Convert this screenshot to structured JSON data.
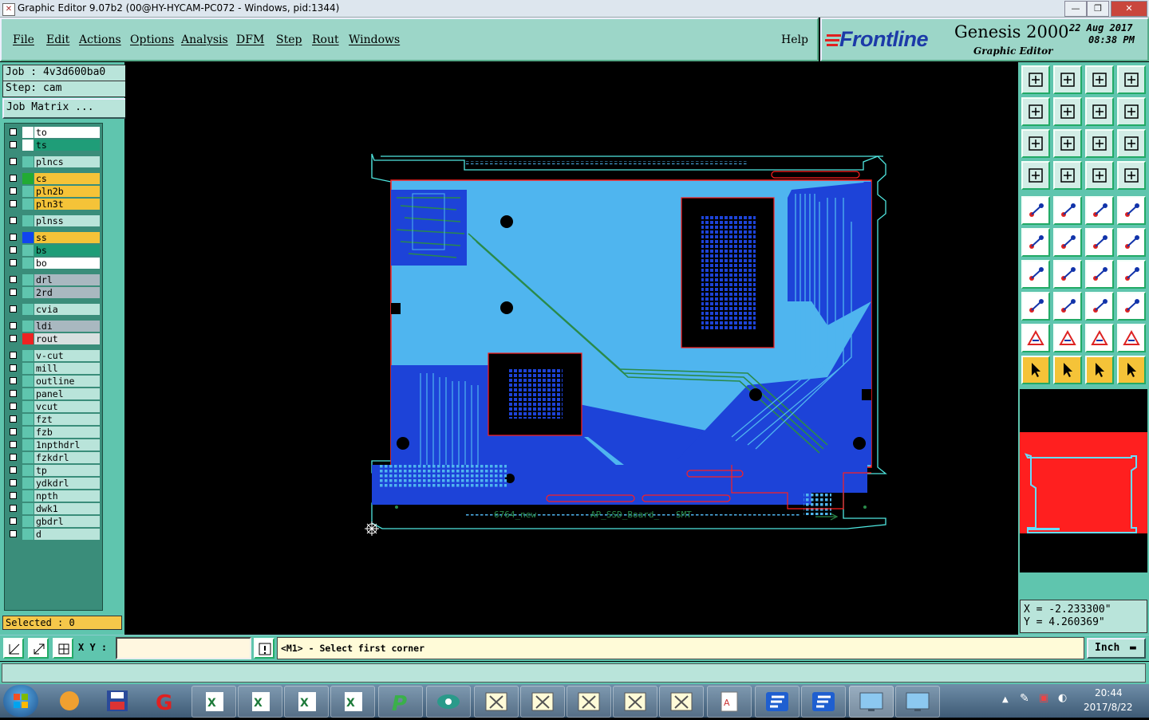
{
  "window": {
    "title": "Graphic Editor 9.07b2 (00@HY-HYCAM-PC072 - Windows, pid:1344)"
  },
  "menu": {
    "items": [
      "File",
      "Edit",
      "Actions",
      "Options",
      "Analysis",
      "DFM",
      "Step",
      "Rout",
      "Windows"
    ],
    "help": "Help"
  },
  "brand": {
    "logo": "Frontline",
    "product": "Genesis 2000",
    "subtitle": "Graphic Editor",
    "date": "22 Aug 2017",
    "time": "08:38 PM"
  },
  "job": {
    "job": "Job : 4v3d600ba0",
    "step": "Step: cam",
    "matrix_button": "Job Matrix ..."
  },
  "layers": [
    {
      "name": "to",
      "color": "#ffffff",
      "swatch": "#ffffff"
    },
    {
      "name": "ts",
      "color": "#1f9d78",
      "swatch": "#ffffff"
    },
    {
      "name": "plncs",
      "color": "#b9e4da",
      "swatch": "#5fc5ae"
    },
    {
      "name": "cs",
      "color": "#f5c338",
      "swatch": "#22aa33"
    },
    {
      "name": "pln2b",
      "color": "#f5c338",
      "swatch": "#5fc5ae"
    },
    {
      "name": "pln3t",
      "color": "#f5c338",
      "swatch": "#5fc5ae"
    },
    {
      "name": "plnss",
      "color": "#b9e4da",
      "swatch": "#5fc5ae"
    },
    {
      "name": "ss",
      "color": "#f5c338",
      "swatch": "#1144ee"
    },
    {
      "name": "bs",
      "color": "#1f9d78",
      "swatch": "#5fc5ae"
    },
    {
      "name": "bo",
      "color": "#ffffff",
      "swatch": "#5fc5ae"
    },
    {
      "name": "drl",
      "color": "#a9b8c0",
      "swatch": "#5fc5ae"
    },
    {
      "name": "2rd",
      "color": "#a9b8c0",
      "swatch": "#5fc5ae"
    },
    {
      "name": "cvia",
      "color": "#b9e4da",
      "swatch": "#5fc5ae"
    },
    {
      "name": "ldi",
      "color": "#a9b8c0",
      "swatch": "#5fc5ae"
    },
    {
      "name": "rout",
      "color": "#d8e0e0",
      "swatch": "#ee2222"
    },
    {
      "name": "v-cut",
      "color": "#b9e4da",
      "swatch": "#5fc5ae"
    },
    {
      "name": "mill",
      "color": "#b9e4da",
      "swatch": "#5fc5ae"
    },
    {
      "name": "outline",
      "color": "#b9e4da",
      "swatch": "#5fc5ae"
    },
    {
      "name": "panel",
      "color": "#b9e4da",
      "swatch": "#5fc5ae"
    },
    {
      "name": "vcut",
      "color": "#b9e4da",
      "swatch": "#5fc5ae"
    },
    {
      "name": "fzt",
      "color": "#b9e4da",
      "swatch": "#5fc5ae"
    },
    {
      "name": "fzb",
      "color": "#b9e4da",
      "swatch": "#5fc5ae"
    },
    {
      "name": "1npthdrl",
      "color": "#b9e4da",
      "swatch": "#5fc5ae"
    },
    {
      "name": "fzkdrl",
      "color": "#b9e4da",
      "swatch": "#5fc5ae"
    },
    {
      "name": "tp",
      "color": "#b9e4da",
      "swatch": "#5fc5ae"
    },
    {
      "name": "ydkdrl",
      "color": "#b9e4da",
      "swatch": "#5fc5ae"
    },
    {
      "name": "npth",
      "color": "#b9e4da",
      "swatch": "#5fc5ae"
    },
    {
      "name": "dwk1",
      "color": "#b9e4da",
      "swatch": "#5fc5ae"
    },
    {
      "name": "gbdrl",
      "color": "#b9e4da",
      "swatch": "#5fc5ae"
    },
    {
      "name": "d",
      "color": "#b9e4da",
      "swatch": "#5fc5ae"
    }
  ],
  "selected": "Selected : 0",
  "board": {
    "label1": "6764_new",
    "label2": "AP_SSD_Board_",
    "label3": "SMT"
  },
  "coordinates": {
    "x": "X = -2.233300\"",
    "y": "Y = 4.260369\""
  },
  "status": {
    "xy_label": "X Y :",
    "xy_value": "",
    "prompt": "<M1> - Select first corner",
    "unit": "Inch"
  },
  "clock": {
    "time": "20:44",
    "date": "2017/8/22"
  },
  "colors": {
    "panel": "#5fc5ae",
    "menubar": "#9cd6c8",
    "board_light": "#4fb5ef",
    "board_dark": "#1d43d8",
    "trace": "#2a8a4a",
    "outline_red": "#ff1f1f"
  }
}
